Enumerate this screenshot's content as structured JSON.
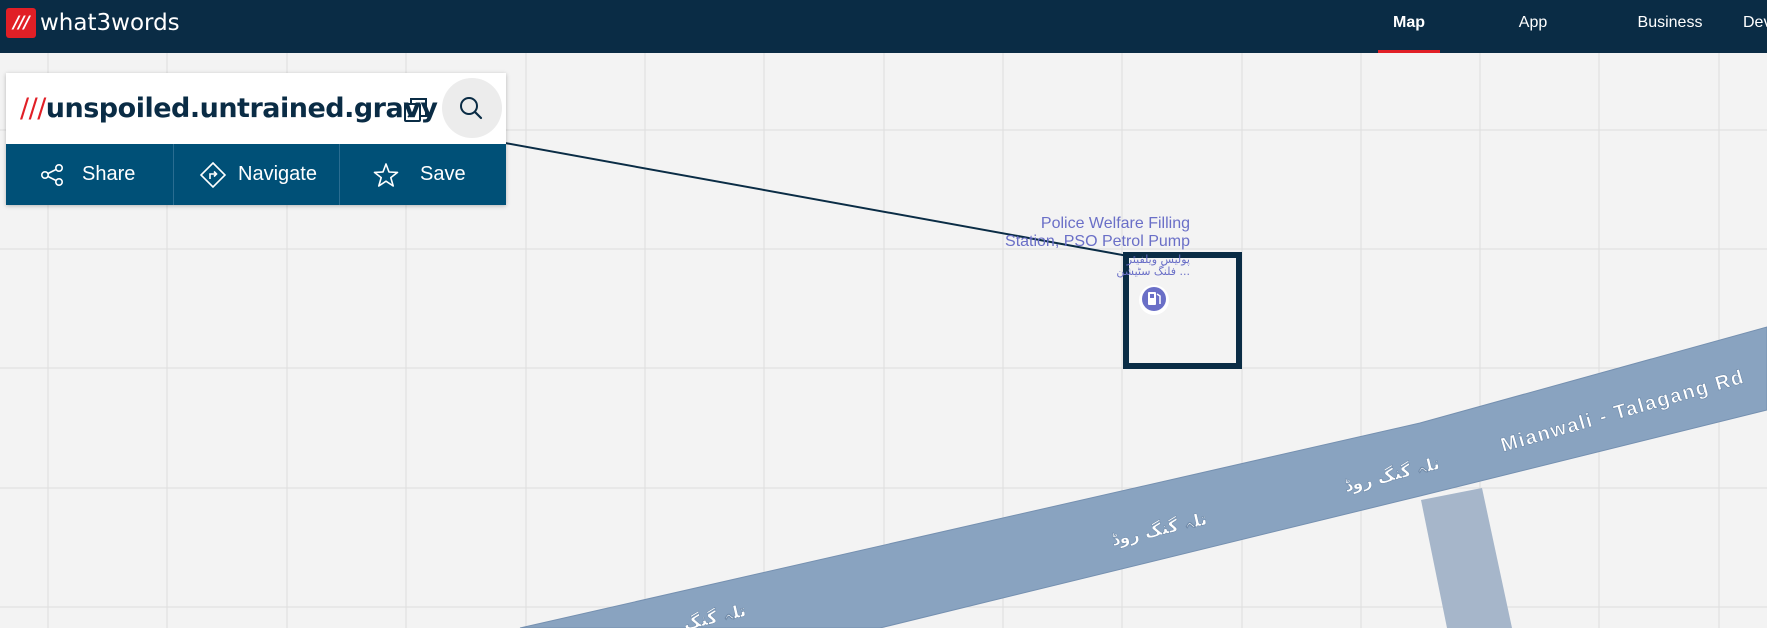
{
  "header": {
    "logo_mark": "///",
    "logo_text": "what3words",
    "nav": [
      {
        "label": "Map",
        "active": true
      },
      {
        "label": "App",
        "active": false
      },
      {
        "label": "Business",
        "active": false
      },
      {
        "label": "Dev",
        "active": false
      }
    ]
  },
  "card": {
    "slashes": "///",
    "words": "unspoiled.untrained.gravy",
    "copy_icon": "copy-icon",
    "search_icon": "search-icon",
    "actions": [
      {
        "label": "Share",
        "icon": "share-icon"
      },
      {
        "label": "Navigate",
        "icon": "navigate-icon"
      },
      {
        "label": "Save",
        "icon": "star-icon"
      }
    ]
  },
  "map": {
    "poi_name_line1": "Police Welfare Filling",
    "poi_name_line2": "Station, PSO Petrol Pump",
    "poi_urdu_line1": "پولیس ویلفیئر",
    "poi_urdu_line2": "فلنگ سٹیشن ...",
    "poi_icon": "fuel-pump-icon",
    "road_name_english": "Mianwali - Talagang Rd",
    "road_name_urdu_1": "تلہ گنگ روڈ",
    "road_name_urdu_2": "تلہ گنگ روڈ",
    "road_name_urdu_3": "تلہ گنگ",
    "colors": {
      "header_bg": "#0a2c45",
      "accent_red": "#e11f26",
      "action_bar": "#005077",
      "road": "#89a3c0",
      "map_bg": "#f3f3f3",
      "poi_text": "#6a6fc7"
    }
  }
}
